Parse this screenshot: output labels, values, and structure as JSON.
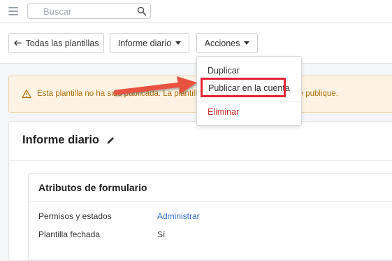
{
  "topbar": {
    "search_placeholder": "Buscar",
    "menu_icon": "hamburger-icon",
    "search_icon": "search-icon"
  },
  "toolbar": {
    "back_label": "Todas las plantillas",
    "back_icon": "arrow-left-icon",
    "report_label": "Informe diario",
    "actions_label": "Acciones"
  },
  "dropdown": {
    "items": [
      "Duplicar",
      "Publicar en la cuenta",
      "Eliminar"
    ]
  },
  "alert": {
    "text": "Esta plantilla no ha sido publicada. La plantilla no será visible hasta que se publique.",
    "icon": "warning-icon"
  },
  "card": {
    "title": "Informe diario",
    "edit_icon": "pencil-icon",
    "section_title": "Atributos de formulario",
    "rows": [
      {
        "label": "Permisos y estados",
        "value": "Administrar"
      },
      {
        "label": "Plantilla fechada",
        "value": "Sí"
      }
    ]
  },
  "colors": {
    "highlight": "#e32636",
    "arrow": "#e8523f",
    "link": "#2f6fcf",
    "warning_text": "#b0700f",
    "danger": "#c9302c"
  }
}
